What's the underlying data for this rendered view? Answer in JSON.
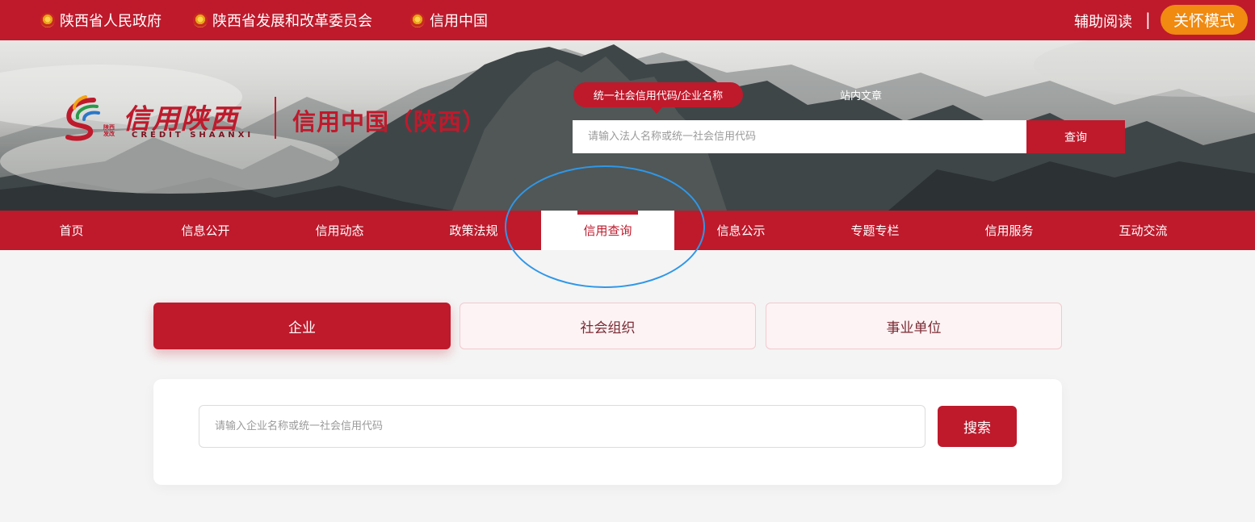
{
  "topbar": {
    "links": [
      "陕西省人民政府",
      "陕西省发展和改革委员会",
      "信用中国"
    ],
    "assist_label": "辅助阅读",
    "separator": "|",
    "care_mode_label": "关怀模式"
  },
  "header": {
    "logo_text": "信用陕西",
    "logo_en": "CREDIT SHAANXI",
    "logo_mini": "陕西发改",
    "site_title": "信用中国（陕西）",
    "search_tabs": [
      "统一社会信用代码/企业名称",
      "站内文章"
    ],
    "search_placeholder": "请输入法人名称或统一社会信用代码",
    "search_button": "查询"
  },
  "nav": {
    "items": [
      "首页",
      "信息公开",
      "信用动态",
      "政策法规",
      "信用查询",
      "信息公示",
      "专题专栏",
      "信用服务",
      "互动交流"
    ],
    "active": "信用查询"
  },
  "query": {
    "tabs": [
      "企业",
      "社会组织",
      "事业单位"
    ],
    "active_tab": "企业",
    "placeholder": "请输入企业名称或统一社会信用代码",
    "button": "搜索"
  },
  "colors": {
    "brand_red": "#be1a2c",
    "care_orange": "#f08a10",
    "annotation_blue": "#2f97e8"
  }
}
